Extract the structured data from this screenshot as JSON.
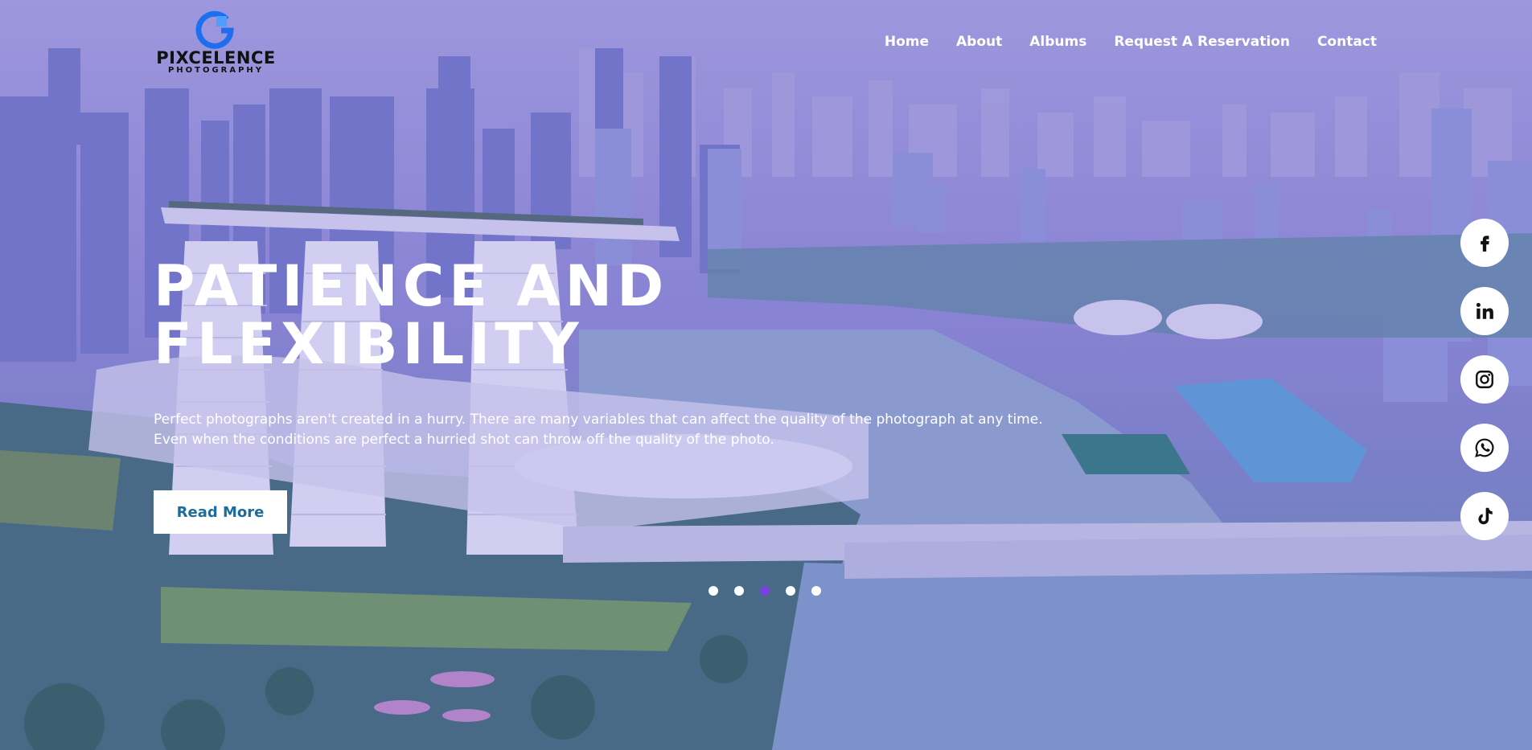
{
  "brand": {
    "name": "PIXCELENCE",
    "tagline": "PHOTOGRAPHY",
    "accent": "#1e6ff0"
  },
  "nav": {
    "items": [
      {
        "label": "Home"
      },
      {
        "label": "About"
      },
      {
        "label": "Albums"
      },
      {
        "label": "Request A Reservation"
      },
      {
        "label": "Contact"
      }
    ]
  },
  "hero": {
    "headline_line1": "PATIENCE AND",
    "headline_line2": "FLEXIBILITY",
    "lead_line1": "Perfect photographs aren't created in a hurry. There are many variables that can affect the quality of the photograph at any time.",
    "lead_line2": "Even when the conditions are perfect a hurried shot can throw off the quality of the photo.",
    "cta_label": "Read More",
    "cta_color": "#1d6d9c"
  },
  "slider": {
    "count": 5,
    "active_index": 2,
    "active_color": "#7a3fe0"
  },
  "social": [
    {
      "icon": "facebook-icon"
    },
    {
      "icon": "linkedin-icon"
    },
    {
      "icon": "instagram-icon"
    },
    {
      "icon": "whatsapp-icon"
    },
    {
      "icon": "tiktok-icon"
    }
  ]
}
